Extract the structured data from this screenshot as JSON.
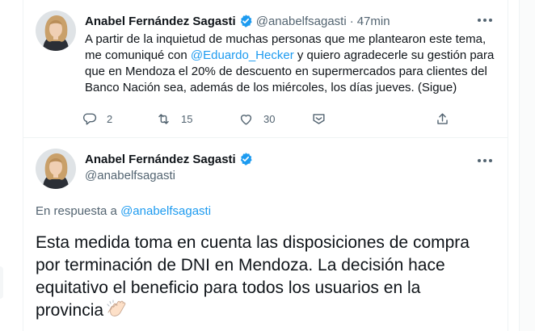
{
  "tweet1": {
    "author_name": "Anabel Fernández Sagasti",
    "handle": "@anabelfsagasti",
    "separator": "·",
    "time": "47min",
    "more_label": "···",
    "text_before": "A partir de la inquietud de muchas personas que me plantearon este tema, me comuniqué con ",
    "mention": "@Eduardo_Hecker",
    "text_after": " y quiero agradecerle su gestión para que en Mendoza el 20% de descuento en supermercados para clientes del Banco Nación sea, además de los miércoles, los días jueves. (Sigue)",
    "actions": {
      "reply_count": "2",
      "retweet_count": "15",
      "like_count": "30"
    }
  },
  "tweet2": {
    "author_name": "Anabel Fernández Sagasti",
    "handle": "@anabelfsagasti",
    "more_label": "···",
    "reply_prefix": "En respuesta a ",
    "reply_handle": "@anabelfsagasti",
    "text": "Esta medida toma en cuenta las disposiciones de compra por terminación de DNI en Mendoza. La decisión hace equitativo el beneficio para todos los usuarios en la provincia"
  },
  "colors": {
    "accent": "#1d9bf0",
    "secondary_text": "#536471",
    "primary_text": "#0f1419",
    "divider": "#eff3f4"
  },
  "icons": [
    "reply-icon",
    "retweet-icon",
    "like-icon",
    "share-icon",
    "upload-icon",
    "verified-badge-icon",
    "clapping-hands-icon",
    "more-icon"
  ]
}
